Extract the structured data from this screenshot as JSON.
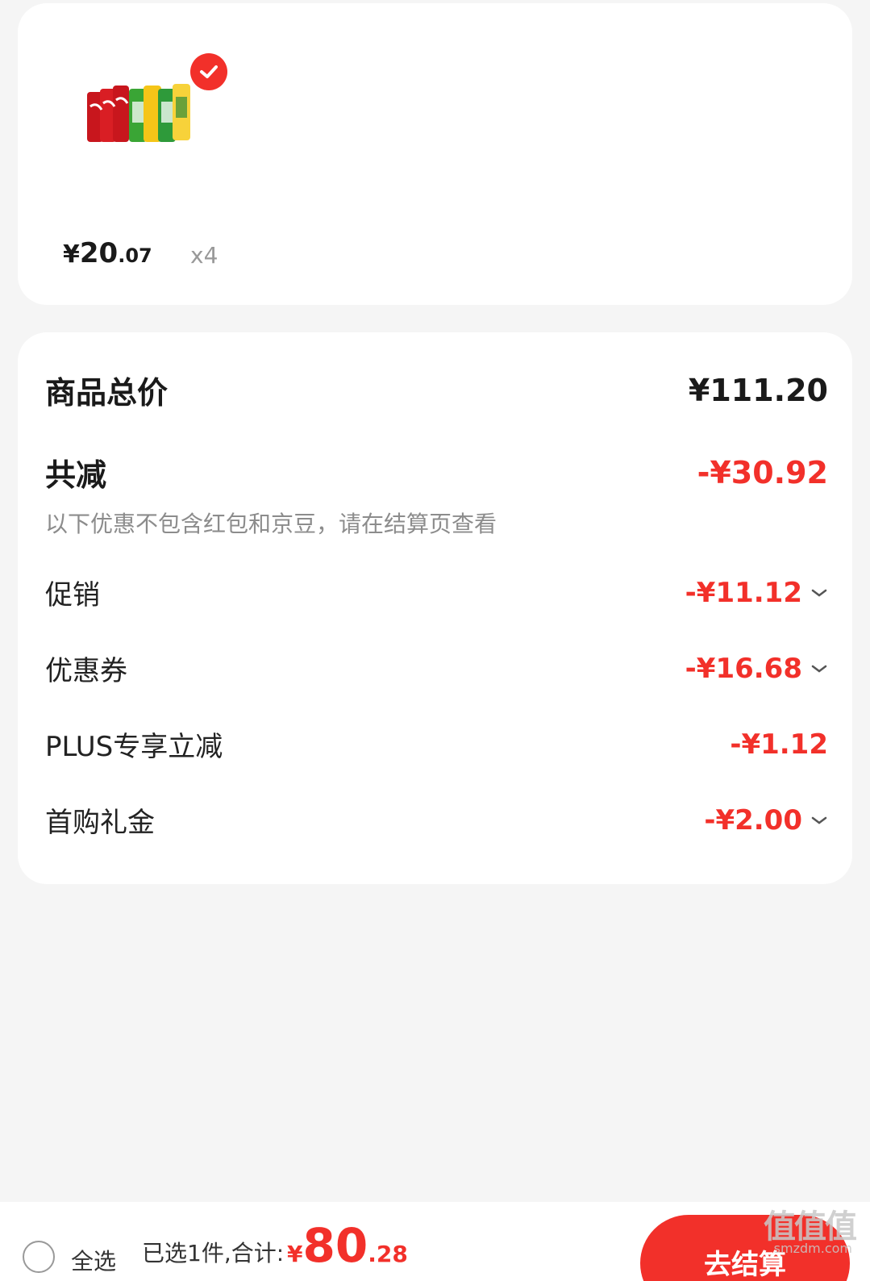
{
  "product": {
    "price_symbol": "¥",
    "price_int": "20",
    "price_dec": ".07",
    "quantity": "x4",
    "selected": true
  },
  "summary": {
    "total_label": "商品总价",
    "total_value": "¥111.20",
    "reduce_label": "共减",
    "reduce_value": "-¥30.92",
    "note": "以下优惠不包含红包和京豆，请在结算页查看",
    "items": [
      {
        "label": "促销",
        "value": "-¥11.12",
        "expandable": true
      },
      {
        "label": "优惠券",
        "value": "-¥16.68",
        "expandable": true
      },
      {
        "label": "PLUS专享立减",
        "value": "-¥1.12",
        "expandable": false
      },
      {
        "label": "首购礼金",
        "value": "-¥2.00",
        "expandable": true
      }
    ]
  },
  "bottom_bar": {
    "select_all_label": "全选",
    "selected_text": "已选1件,合计:",
    "total_symbol": "¥",
    "total_int": "80",
    "total_dec": ".28",
    "checkout_label": "去结算"
  },
  "watermark": {
    "text": "值值值",
    "sub": "smzdm.com"
  },
  "colors": {
    "accent": "#f2302a",
    "background": "#f5f5f5",
    "card": "#ffffff"
  }
}
